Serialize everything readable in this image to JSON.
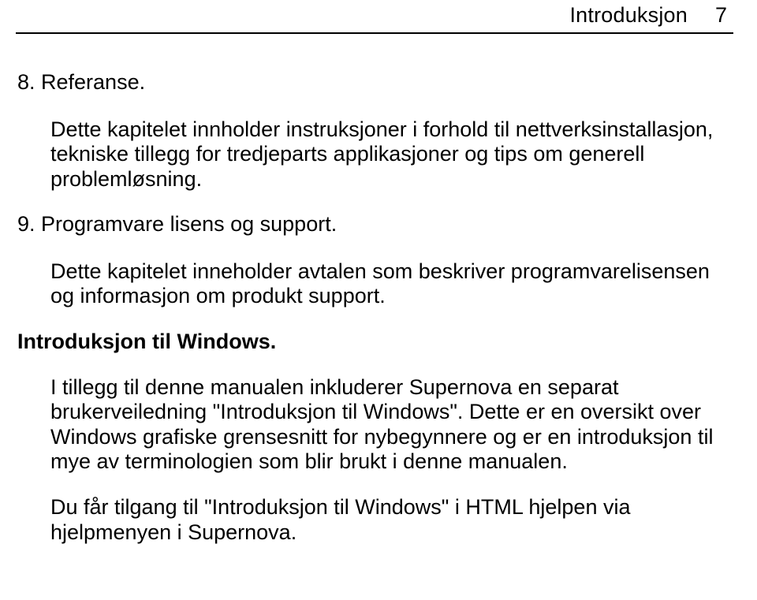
{
  "header": {
    "title": "Introduksjon",
    "page_number": "7"
  },
  "section1": {
    "title": "8. Referanse.",
    "body": "Dette kapitelet innholder instruksjoner i forhold til nettverksinstallasjon, tekniske tillegg for tredjeparts applikasjoner og tips om generell problemløsning."
  },
  "section2": {
    "title": "9. Programvare lisens og support.",
    "body": "Dette kapitelet inneholder avtalen som beskriver programvarelisensen og informasjon om produkt support."
  },
  "section3": {
    "title": "Introduksjon til Windows.",
    "body1": "I tillegg til denne manualen inkluderer Supernova en separat brukerveiledning \"Introduksjon til Windows\". Dette er en oversikt over Windows grafiske grensesnitt for nybegynnere og er en introduksjon til mye av terminologien som blir brukt i denne manualen.",
    "body2": "Du får tilgang til \"Introduksjon til Windows\" i HTML hjelpen via hjelpmenyen i Supernova."
  }
}
